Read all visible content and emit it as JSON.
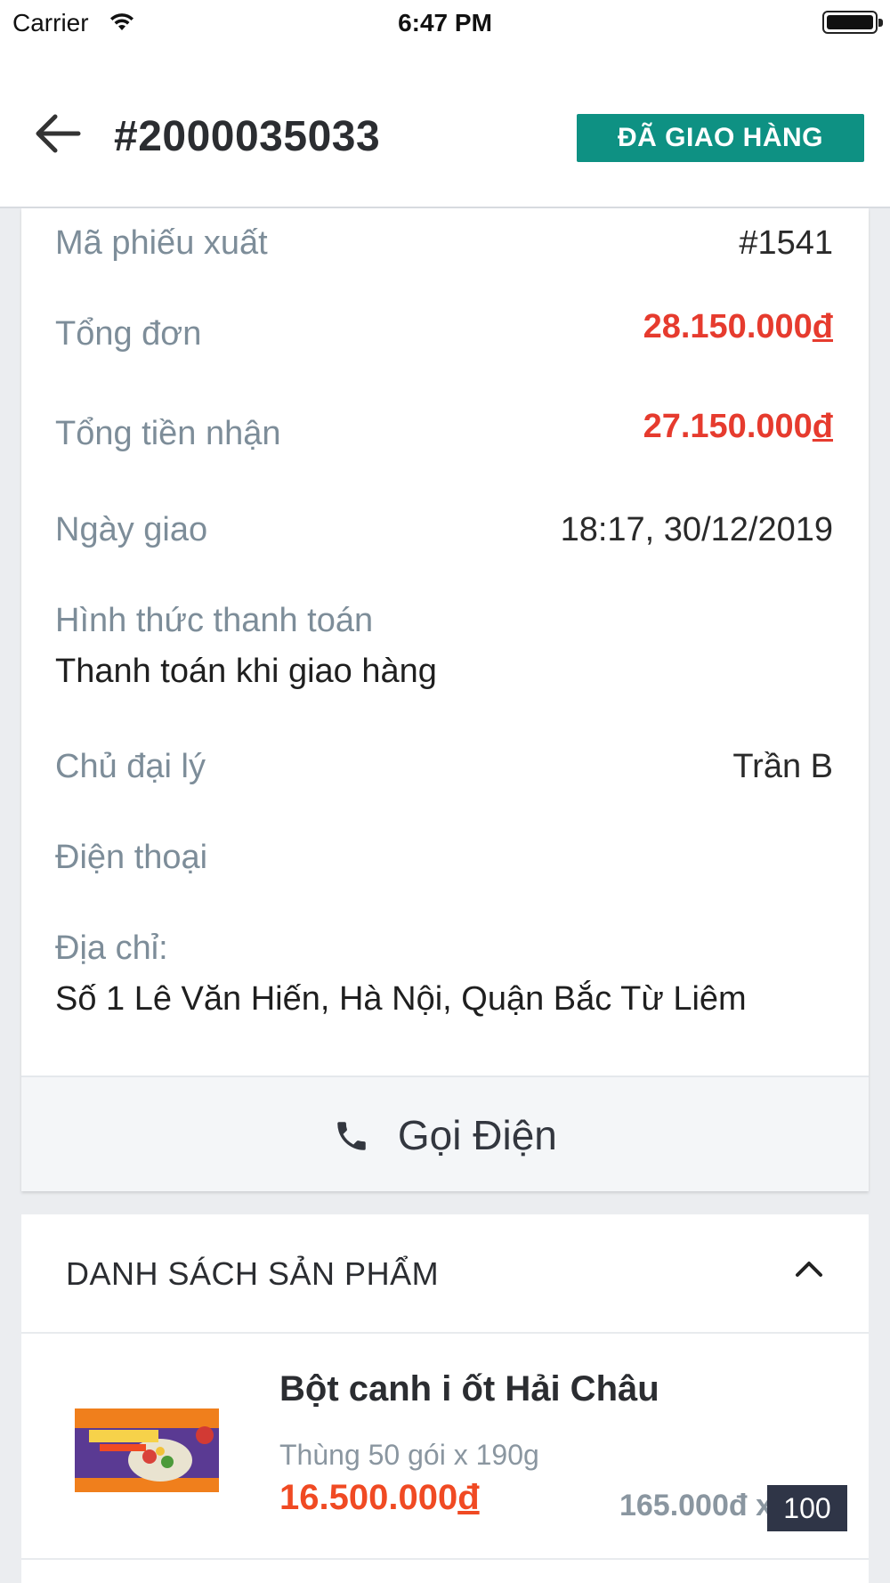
{
  "status_bar": {
    "carrier": "Carrier",
    "time": "6:47 PM"
  },
  "header": {
    "title": "#2000035033",
    "status_badge": "ĐÃ GIAO HÀNG"
  },
  "order_info": {
    "export_code_label": "Mã phiếu xuất",
    "export_code_value": "#1541",
    "order_total_label": "Tổng đơn",
    "order_total_value": "28.150.000",
    "received_total_label": "Tổng tiền nhận",
    "received_total_value": "27.150.000",
    "currency_symbol": "đ",
    "delivery_date_label": "Ngày giao",
    "delivery_date_value": "18:17, 30/12/2019",
    "payment_method_label": "Hình thức thanh toán",
    "payment_method_value": "Thanh toán khi giao hàng",
    "agent_owner_label": "Chủ đại lý",
    "agent_owner_value": "Trần B",
    "phone_label": "Điện thoại",
    "phone_value": "",
    "address_label": "Địa chỉ:",
    "address_value": "Số 1 Lê Văn Hiến, Hà Nội, Quận Bắc Từ Liêm"
  },
  "call_button": {
    "label": "Gọi Điện",
    "icon": "phone-icon"
  },
  "product_list": {
    "header": "DANH SÁCH SẢN PHẨM",
    "toggle_icon": "chevron-up-icon",
    "items": [
      {
        "name": "Bột canh i ốt Hải Châu",
        "packaging": "Thùng 50 gói x 190g",
        "line_total": "16.500.000",
        "unit_price": "165.000đ x",
        "quantity": "100"
      }
    ]
  },
  "colors": {
    "badge_green": "#0e9183",
    "price_red": "#e63b2e",
    "product_price_orange": "#f04a23",
    "label_gray": "#7d8d99",
    "qty_box": "#2f3547"
  }
}
